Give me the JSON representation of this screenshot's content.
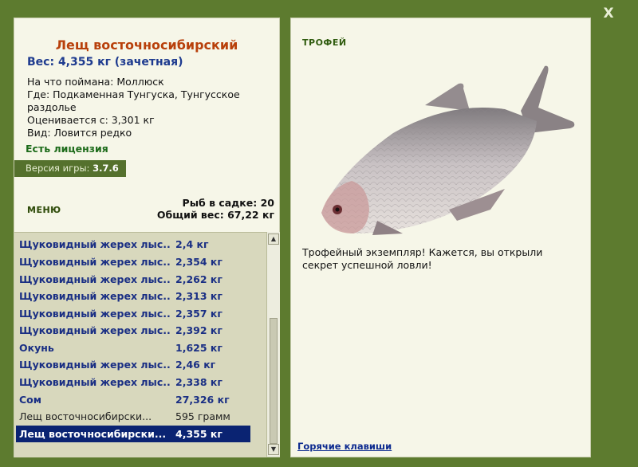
{
  "window": {
    "close_label": "X"
  },
  "fish": {
    "title": "Лещ восточносибирский",
    "weight": "Вес: 4,355 кг (зачетная)",
    "bait": "На что поймана: Моллюск",
    "place_line1": "Где: Подкаменная Тунгуска, Тунгусское",
    "place_line2": "раздолье",
    "valued": "Оценивается с: 3,301 кг",
    "kind": "Вид: Ловится редко"
  },
  "license": "Есть лицензия",
  "version": {
    "label": "Версия игры:",
    "value": "3.7.6"
  },
  "menu_label": "МЕНЮ",
  "keepnet": {
    "count": "Рыб в садке: 20",
    "total": "Общий вес: 67,22 кг"
  },
  "catch_list": [
    {
      "name": "Щуковидный жерех лыс...",
      "weight": "2,4 кг"
    },
    {
      "name": "Щуковидный жерех лыс...",
      "weight": "2,354 кг"
    },
    {
      "name": "Щуковидный жерех лыс...",
      "weight": "2,262 кг"
    },
    {
      "name": "Щуковидный жерех лыс...",
      "weight": "2,313 кг"
    },
    {
      "name": "Щуковидный жерех лыс...",
      "weight": "2,357 кг"
    },
    {
      "name": "Щуковидный жерех лыс...",
      "weight": "2,392 кг"
    },
    {
      "name": "Окунь",
      "weight": "1,625 кг"
    },
    {
      "name": "Щуковидный жерех лыс...",
      "weight": "2,46 кг"
    },
    {
      "name": "Щуковидный жерех лыс...",
      "weight": "2,338 кг"
    },
    {
      "name": "Сом",
      "weight": "27,326 кг"
    },
    {
      "name": "Лещ восточносибирски...",
      "weight": "595 грамм"
    },
    {
      "name": "Лещ восточносибирски...",
      "weight": "4,355 кг"
    }
  ],
  "trophy": {
    "label": "ТРОФЕЙ",
    "text": "Трофейный экземпляр! Кажется, вы открыли секрет успешной ловли!"
  },
  "hotkeys_label": "Горячие клавиши"
}
